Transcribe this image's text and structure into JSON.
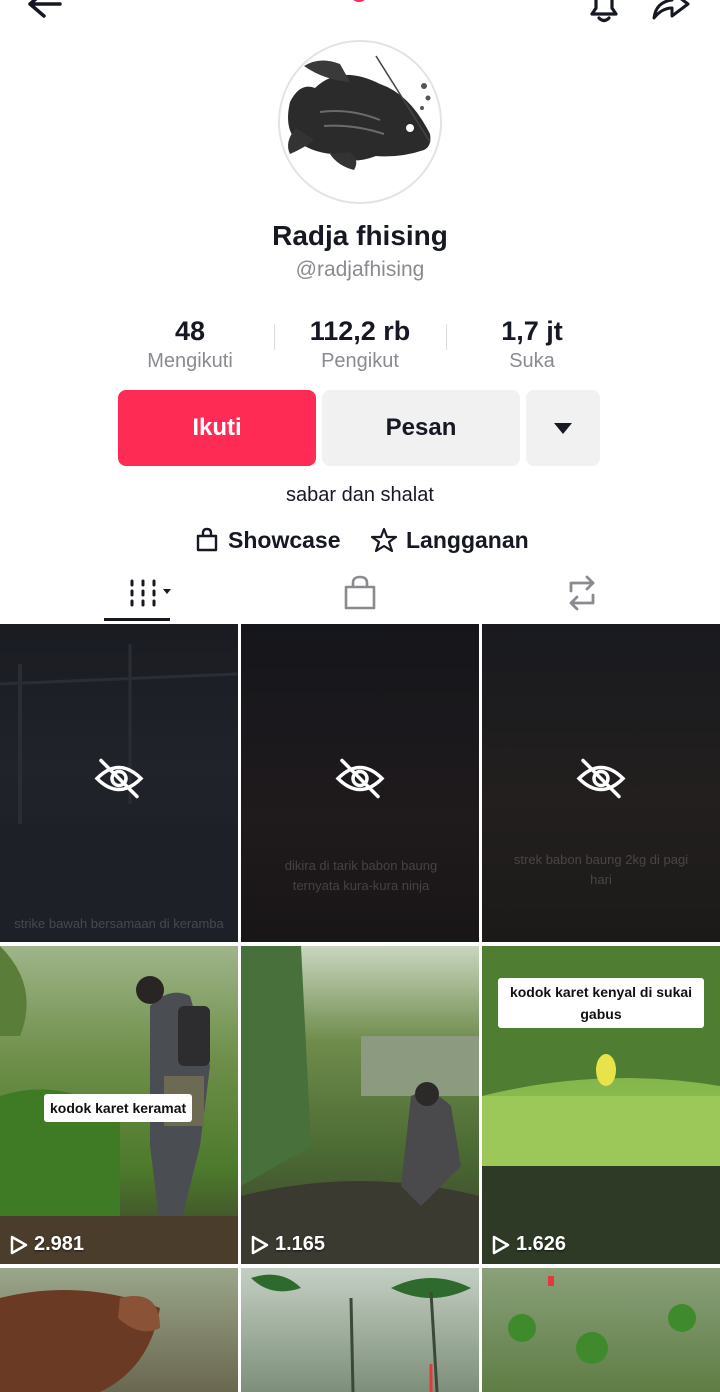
{
  "profile": {
    "name": "Radja fhising",
    "handle": "@radjafhising",
    "bio": "sabar dan shalat"
  },
  "stats": [
    {
      "value": "48",
      "label": "Mengikuti"
    },
    {
      "value": "112,2 rb",
      "label": "Pengikut"
    },
    {
      "value": "1,7 jt",
      "label": "Suka"
    }
  ],
  "actions": {
    "follow_label": "Ikuti",
    "message_label": "Pesan",
    "more_icon": "caret-down-icon"
  },
  "links": {
    "showcase_label": "Showcase",
    "subscription_label": "Langganan"
  },
  "tabs": [
    {
      "icon": "grid-icon",
      "active": true
    },
    {
      "icon": "shopping-bag-icon",
      "active": false
    },
    {
      "icon": "repost-icon",
      "active": false
    }
  ],
  "videos": [
    {
      "hidden": true,
      "faint_caption": "strike bawah bersamaan di keramba"
    },
    {
      "hidden": true,
      "faint_caption": "dikira di tarik babon baung ternyata kura-kura ninja"
    },
    {
      "hidden": true,
      "faint_caption": "strek babon baung 2kg di pagi hari"
    },
    {
      "hidden": false,
      "caption": "kodok karet keramat",
      "views": "2.981"
    },
    {
      "hidden": false,
      "caption": "",
      "views": "1.165"
    },
    {
      "hidden": false,
      "caption": "kodok karet kenyal di sukai gabus",
      "views": "1.626"
    },
    {
      "hidden": false,
      "caption": "",
      "views": ""
    },
    {
      "hidden": false,
      "caption": "",
      "views": ""
    },
    {
      "hidden": false,
      "caption": "",
      "views": ""
    }
  ],
  "colors": {
    "accent": "#fe2c55",
    "secondary_button": "#f1f1f2",
    "muted_text": "#8a8b91"
  }
}
